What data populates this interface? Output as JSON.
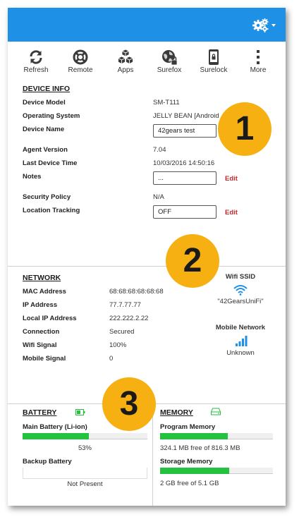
{
  "toolbar": {
    "items": [
      {
        "label": "Refresh"
      },
      {
        "label": "Remote"
      },
      {
        "label": "Apps"
      },
      {
        "label": "Surefox"
      },
      {
        "label": "Surelock"
      },
      {
        "label": "More"
      }
    ]
  },
  "device_info": {
    "title": "DEVICE INFO",
    "device_model_label": "Device Model",
    "device_model": "SM-T111",
    "os_label": "Operating System",
    "os": "JELLY BEAN [Android",
    "device_name_label": "Device Name",
    "device_name": "42gears test",
    "agent_version_label": "Agent Version",
    "agent_version": "7.04",
    "last_time_label": "Last Device Time",
    "last_time": "10/03/2016 14:50:16",
    "notes_label": "Notes",
    "notes": "...",
    "notes_edit": "Edit",
    "security_label": "Security Policy",
    "security": "N/A",
    "location_label": "Location Tracking",
    "location": "OFF",
    "location_edit": "Edit"
  },
  "network": {
    "title": "NETWORK",
    "mac_label": "MAC Address",
    "mac": "68:68:68:68:68:68",
    "ip_label": "IP Address",
    "ip": "77.7.77.77",
    "local_ip_label": "Local IP Address",
    "local_ip": "222.222.2.22",
    "connection_label": "Connection",
    "connection": "Secured",
    "wifi_signal_label": "Wifi Signal",
    "wifi_signal": "100%",
    "mobile_signal_label": "Mobile Signal",
    "mobile_signal": "0",
    "wifi_ssid_label": "Wifi SSID",
    "wifi_ssid": "\"42GearsUniFi\"",
    "mobile_network_label": "Mobile Network",
    "mobile_network": "Unknown"
  },
  "battery": {
    "title": "BATTERY",
    "main_label": "Main Battery (Li-ion)",
    "main_percent": "53%",
    "main_fraction": 0.53,
    "backup_label": "Backup Battery",
    "backup_status": "Not Present"
  },
  "memory": {
    "title": "MEMORY",
    "program_label": "Program Memory",
    "program_text": "324.1 MB free of 816.3 MB",
    "program_fraction": 0.6,
    "storage_label": "Storage Memory",
    "storage_text": "2 GB free of 5.1 GB",
    "storage_fraction": 0.61
  },
  "badges": [
    "1",
    "2",
    "3"
  ],
  "colors": {
    "topbar": "#1e90e6",
    "badge": "#f7b011",
    "edit": "#c0282b",
    "bar": "#23c23f"
  }
}
